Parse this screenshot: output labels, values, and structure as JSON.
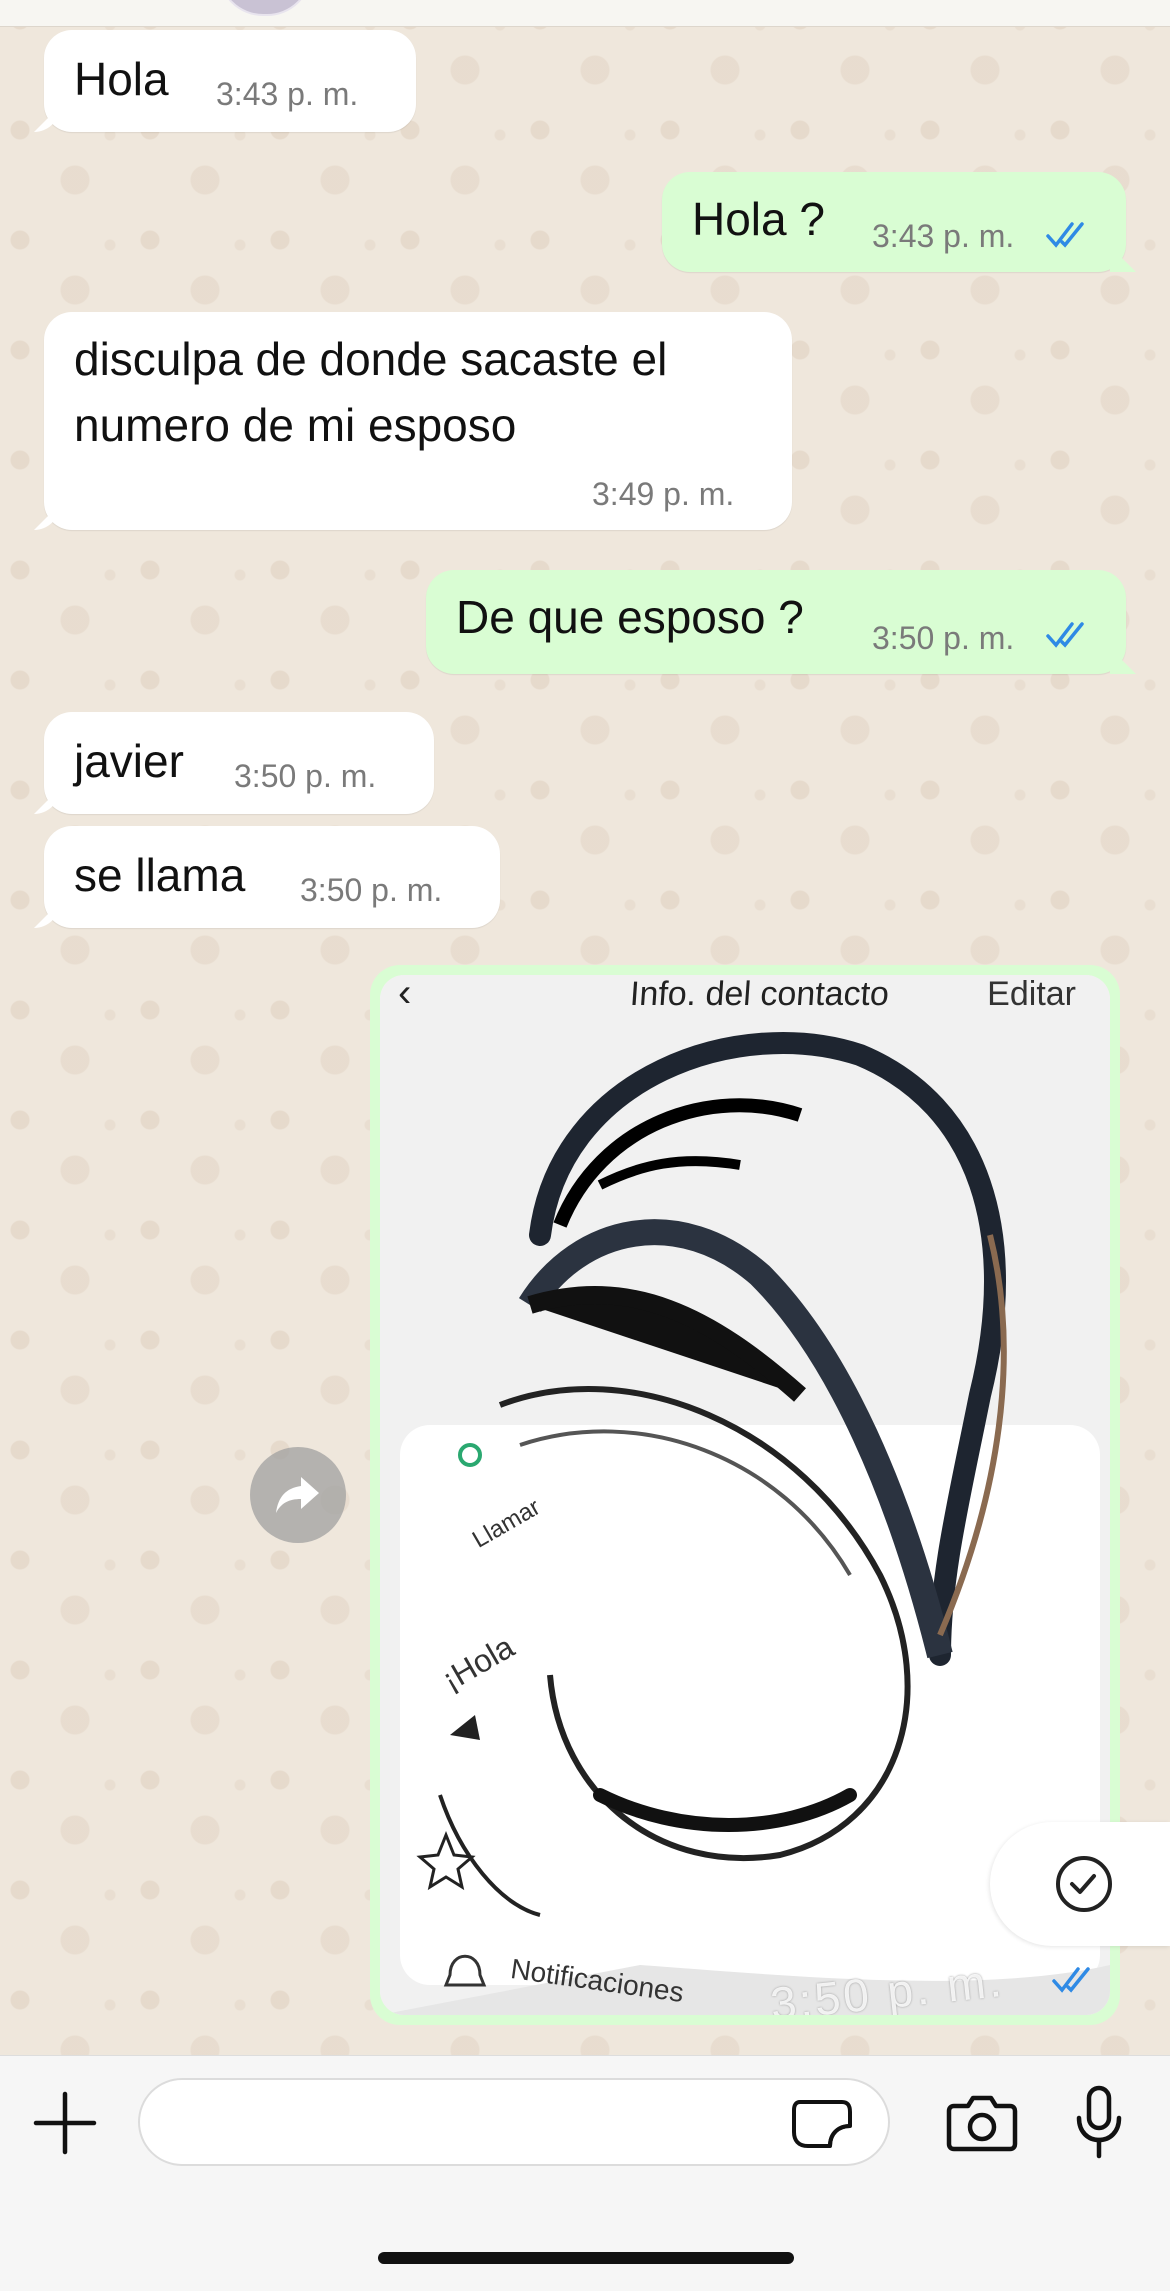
{
  "messages": [
    {
      "direction": "in",
      "text": "Hola",
      "time": "3:43 p. m."
    },
    {
      "direction": "out",
      "text": "Hola ?",
      "time": "3:43 p. m.",
      "status": "read"
    },
    {
      "direction": "in",
      "text": "disculpa de donde sacaste el\nnumero de mi esposo",
      "time": "3:49 p. m."
    },
    {
      "direction": "out",
      "text": "De que esposo ?",
      "time": "3:50 p. m.",
      "status": "read"
    },
    {
      "direction": "in",
      "text": "javier",
      "time": "3:50 p. m."
    },
    {
      "direction": "in",
      "text": "se llama",
      "time": "3:50 p. m."
    }
  ],
  "image_message": {
    "header_title": "Info. del contacto",
    "header_edit": "Editar",
    "llamar": "Llamar",
    "hola": "¡Hola",
    "notificaciones": "Notificaciones",
    "time": "3:50 p. m.",
    "status": "read"
  },
  "icons": {
    "forward": "forward-icon",
    "select": "check-circle-icon",
    "plus": "plus-icon",
    "sticker": "sticker-icon",
    "camera": "camera-icon",
    "mic": "microphone-icon"
  },
  "colors": {
    "incoming": "#ffffff",
    "outgoing": "#d9fdd3",
    "read_check": "#2f8ae5",
    "wallpaper": "#efe7dc"
  }
}
